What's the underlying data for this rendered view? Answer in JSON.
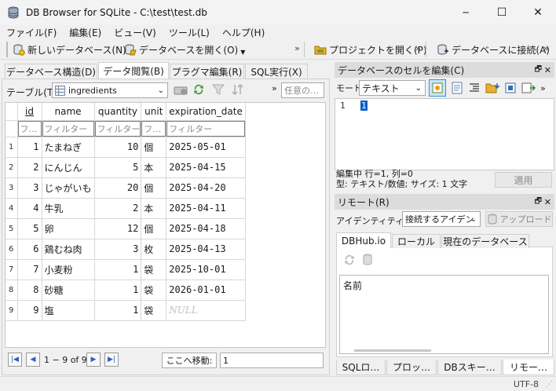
{
  "window": {
    "title": "DB Browser for SQLite - C:\\test\\test.db",
    "minimize": "─",
    "maximize": "☐",
    "close": "✕"
  },
  "menu": [
    "ファイル(F)",
    "編集(E)",
    "ビュー(V)",
    "ツール(L)",
    "ヘルプ(H)"
  ],
  "toolbar": {
    "new_db": "新しいデータベース(N)",
    "open_db": "データベースを開く(O)",
    "open_project": "プロジェクトを開く(P)",
    "connect_db": "データベースに接続(A)",
    "more": "»"
  },
  "main_tabs": [
    "データベース構造(D)",
    "データ閲覧(B)",
    "プラグマ編集(R)",
    "SQL実行(X)"
  ],
  "browse": {
    "table_label": "テーブル(T):",
    "table_selected": "ingredients",
    "filter_any_placeholder": "任意の…",
    "more": "»"
  },
  "grid": {
    "columns": [
      "id",
      "name",
      "quantity",
      "unit",
      "expiration_date"
    ],
    "filters": [
      "フ…",
      "フィルター",
      "フィルター",
      "フ…",
      "フィルター"
    ],
    "rows": [
      {
        "rn": "1",
        "id": "1",
        "name": "たまねぎ",
        "quantity": "10",
        "unit": "個",
        "exp": "2025-05-01"
      },
      {
        "rn": "2",
        "id": "2",
        "name": "にんじん",
        "quantity": "5",
        "unit": "本",
        "exp": "2025-04-15"
      },
      {
        "rn": "3",
        "id": "3",
        "name": "じゃがいも",
        "quantity": "20",
        "unit": "個",
        "exp": "2025-04-20"
      },
      {
        "rn": "4",
        "id": "4",
        "name": "牛乳",
        "quantity": "2",
        "unit": "本",
        "exp": "2025-04-11"
      },
      {
        "rn": "5",
        "id": "5",
        "name": "卵",
        "quantity": "12",
        "unit": "個",
        "exp": "2025-04-18"
      },
      {
        "rn": "6",
        "id": "6",
        "name": "鶏むね肉",
        "quantity": "3",
        "unit": "枚",
        "exp": "2025-04-13"
      },
      {
        "rn": "7",
        "id": "7",
        "name": "小麦粉",
        "quantity": "1",
        "unit": "袋",
        "exp": "2025-10-01"
      },
      {
        "rn": "8",
        "id": "8",
        "name": "砂糖",
        "quantity": "1",
        "unit": "袋",
        "exp": "2026-01-01"
      },
      {
        "rn": "9",
        "id": "9",
        "name": "塩",
        "quantity": "1",
        "unit": "袋",
        "exp": "NULL"
      }
    ]
  },
  "pager": {
    "range": "1 − 9 of 9",
    "goto_button": "ここへ移動:",
    "goto_value": "1"
  },
  "cell_editor": {
    "title": "データベースのセルを編集(C)",
    "mode_label": "モード:",
    "mode_value": "テキスト",
    "line_number": "1",
    "content": "1",
    "status_line1": "編集中 行=1, 列=0",
    "status_line2": "型: テキスト/数値; サイズ: 1 文字",
    "apply": "適用"
  },
  "remote": {
    "title": "リモート(R)",
    "identity_label": "アイデンティティー",
    "identity_value": "接続するアイデン",
    "upload": "アップロード",
    "tabs": [
      "DBHub.io",
      "ローカル",
      "現在のデータベース"
    ],
    "name_header": "名前"
  },
  "bottom_tabs": [
    "SQLロ…",
    "プロッ…",
    "DBスキー…",
    "リモー…"
  ],
  "status_bar": {
    "encoding": "UTF-8"
  }
}
